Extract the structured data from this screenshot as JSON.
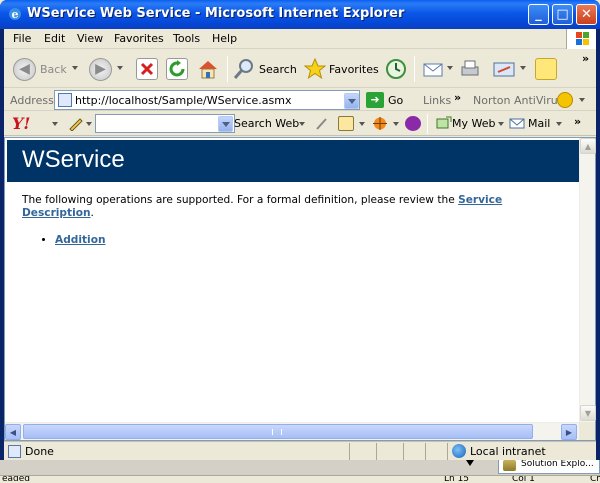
{
  "window": {
    "title": "WService Web Service - Microsoft Internet Explorer"
  },
  "menu": [
    "File",
    "Edit",
    "View",
    "Favorites",
    "Tools",
    "Help"
  ],
  "toolbar": {
    "back": "Back",
    "search": "Search",
    "favorites": "Favorites"
  },
  "address": {
    "label": "Address",
    "url": "http://localhost/Sample/WService.asmx",
    "go": "Go",
    "links": "Links",
    "norton": "Norton AntiVirus"
  },
  "yahoo": {
    "logo": "Y!",
    "search_button": "Search Web",
    "my_web": "My Web",
    "mail": "Mail"
  },
  "page": {
    "heading": "WService",
    "intro_text": "The following operations are supported. For a formal definition, please review the ",
    "service_link": "Service Description",
    "intro_end": ".",
    "operations": [
      "Addition"
    ]
  },
  "status": {
    "text": "Done",
    "zone": "Local intranet"
  },
  "desktop": {
    "tab_label": "Solution Explo...",
    "left_fragment": "eaded",
    "mid_fragment": "Ln 15",
    "col": "Col 1",
    "right_fragment": "Ch"
  }
}
